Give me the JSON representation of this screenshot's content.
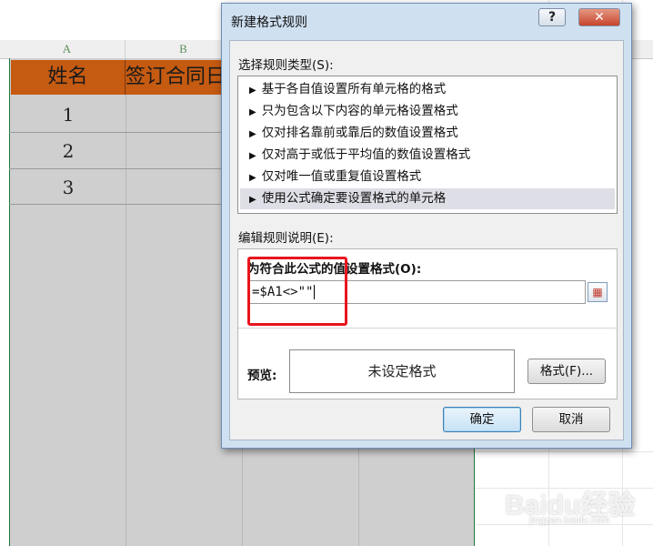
{
  "spreadsheet": {
    "columns": [
      "A",
      "B"
    ],
    "header_cells": [
      "姓名",
      "签订合同日"
    ],
    "rows": [
      "1",
      "2",
      "3"
    ],
    "header_fill": "#c55a11"
  },
  "dialog": {
    "title": "新建格式规则",
    "help_label": "?",
    "close_label": "✕",
    "rule_type_label": "选择规则类型(S):",
    "rule_types": [
      "基于各自值设置所有单元格的格式",
      "只为包含以下内容的单元格设置格式",
      "仅对排名靠前或靠后的数值设置格式",
      "仅对高于或低于平均值的数值设置格式",
      "仅对唯一值或重复值设置格式",
      "使用公式确定要设置格式的单元格"
    ],
    "selected_rule_index": 5,
    "edit_label": "编辑规则说明(E):",
    "formula_label": "为符合此公式的值设置格式(O):",
    "formula_value": "=$A1<>\"\"",
    "preview_label": "预览:",
    "preview_text": "未设定格式",
    "format_button": "格式(F)...",
    "ok_button": "确定",
    "cancel_button": "取消",
    "highlight_color": "#e8141d"
  },
  "watermark": {
    "text": "Baidu经验",
    "subtext": "jingyan.baidu.com"
  }
}
